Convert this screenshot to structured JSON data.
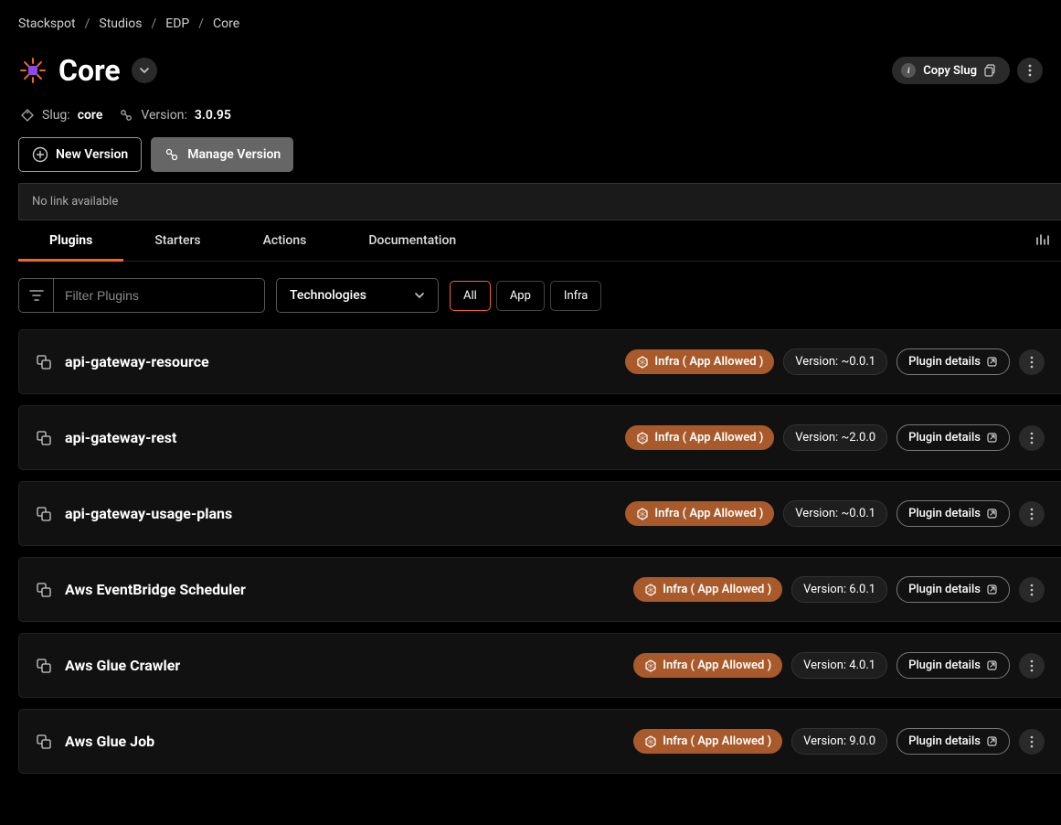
{
  "breadcrumb": [
    "Stackspot",
    "Studios",
    "EDP",
    "Core"
  ],
  "page": {
    "title": "Core",
    "copy_slug_label": "Copy Slug"
  },
  "meta": {
    "slug_label": "Slug:",
    "slug_value": "core",
    "version_label": "Version:",
    "version_value": "3.0.95"
  },
  "actions": {
    "new_version": "New Version",
    "manage_version": "Manage Version"
  },
  "no_link": "No link available",
  "tabs": {
    "plugins": "Plugins",
    "starters": "Starters",
    "actions": "Actions",
    "documentation": "Documentation"
  },
  "filters": {
    "placeholder": "Filter Plugins",
    "technologies": "Technologies",
    "chip_all": "All",
    "chip_app": "App",
    "chip_infra": "Infra"
  },
  "badge_infra_label": "Infra ( App Allowed )",
  "version_prefix": "Version: ",
  "details_label": "Plugin details",
  "plugins": [
    {
      "name": "api-gateway-resource",
      "version": "~0.0.1"
    },
    {
      "name": "api-gateway-rest",
      "version": "~2.0.0"
    },
    {
      "name": "api-gateway-usage-plans",
      "version": "~0.0.1"
    },
    {
      "name": "Aws EventBridge Scheduler",
      "version": "6.0.1"
    },
    {
      "name": "Aws Glue Crawler",
      "version": "4.0.1"
    },
    {
      "name": "Aws Glue Job",
      "version": "9.0.0"
    }
  ]
}
